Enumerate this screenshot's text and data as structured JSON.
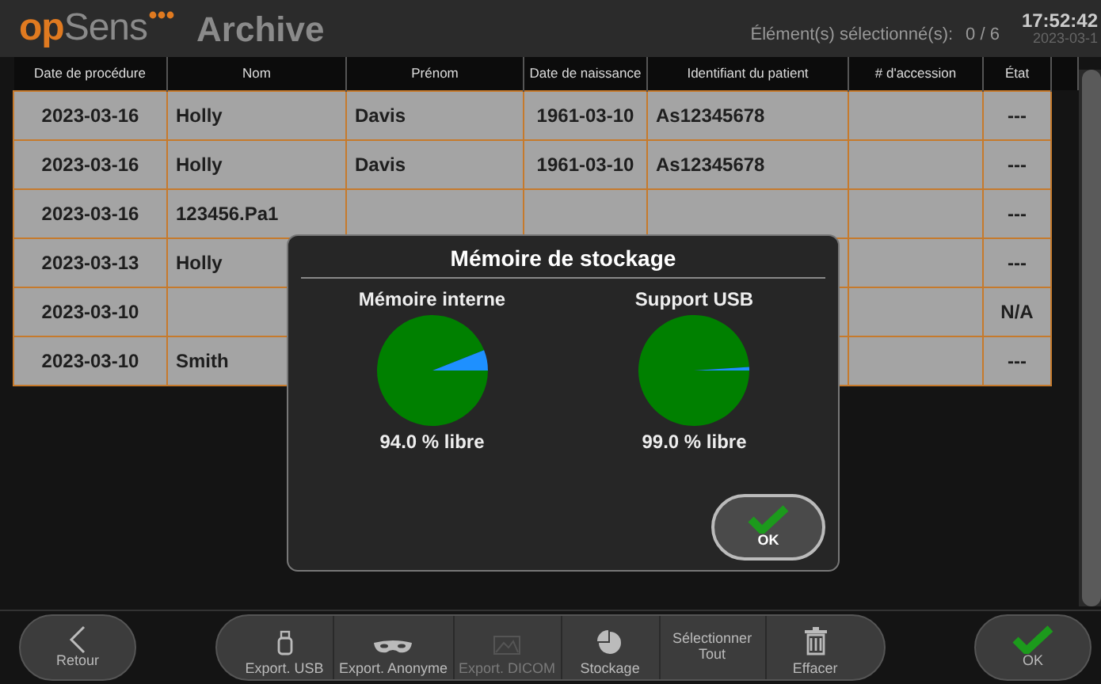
{
  "header": {
    "logo_accent": "op",
    "logo_rest": "Sens",
    "title": "Archive",
    "selection_label": "Élément(s) sélectionné(s):",
    "selection_count": "0 / 6",
    "time": "17:52:42",
    "date": "2023-03-1"
  },
  "table": {
    "columns": [
      "Date de procédure",
      "Nom",
      "Prénom",
      "Date de naissance",
      "Identifiant du patient",
      "# d'accession",
      "État"
    ],
    "rows": [
      {
        "cells": [
          "2023-03-16",
          "Holly",
          "Davis",
          "1961-03-10",
          "As12345678",
          null,
          "---"
        ]
      },
      {
        "cells": [
          "2023-03-16",
          "Holly",
          "Davis",
          "1961-03-10",
          "As12345678",
          null,
          "---"
        ]
      },
      {
        "cells": [
          "2023-03-16",
          "123456.Pa1",
          null,
          null,
          null,
          null,
          "---"
        ]
      },
      {
        "cells": [
          "2023-03-13",
          "Holly",
          null,
          null,
          null,
          null,
          "---"
        ]
      },
      {
        "cells": [
          "2023-03-10",
          null,
          null,
          null,
          null,
          null,
          "N/A"
        ]
      },
      {
        "cells": [
          "2023-03-10",
          "Smith",
          null,
          null,
          null,
          null,
          "---"
        ]
      }
    ]
  },
  "dialog": {
    "title": "Mémoire de stockage",
    "panels": [
      {
        "label": "Mémoire interne",
        "reading": "94.0 % libre",
        "chart_data": {
          "type": "pie",
          "values": [
            94.0,
            6.0
          ]
        }
      },
      {
        "label": "Support USB",
        "reading": "99.0 % libre",
        "chart_data": {
          "type": "pie",
          "values": [
            99.0,
            1.0
          ]
        }
      }
    ],
    "ok_button": "OK"
  },
  "toolbar": {
    "back": "Retour",
    "actions": [
      {
        "kind": "usb",
        "label": "Export. USB",
        "disabled": false
      },
      {
        "kind": "mask",
        "label": "Export. Anonyme",
        "disabled": false
      },
      {
        "kind": "image",
        "label": "Export. DICOM",
        "disabled": true
      },
      {
        "kind": "pie",
        "label": "Stockage",
        "disabled": false
      },
      {
        "kind": "none",
        "label": "Sélectionner Tout",
        "disabled": false
      },
      {
        "kind": "trash",
        "label": "Effacer",
        "disabled": false
      }
    ],
    "ok": "OK"
  }
}
